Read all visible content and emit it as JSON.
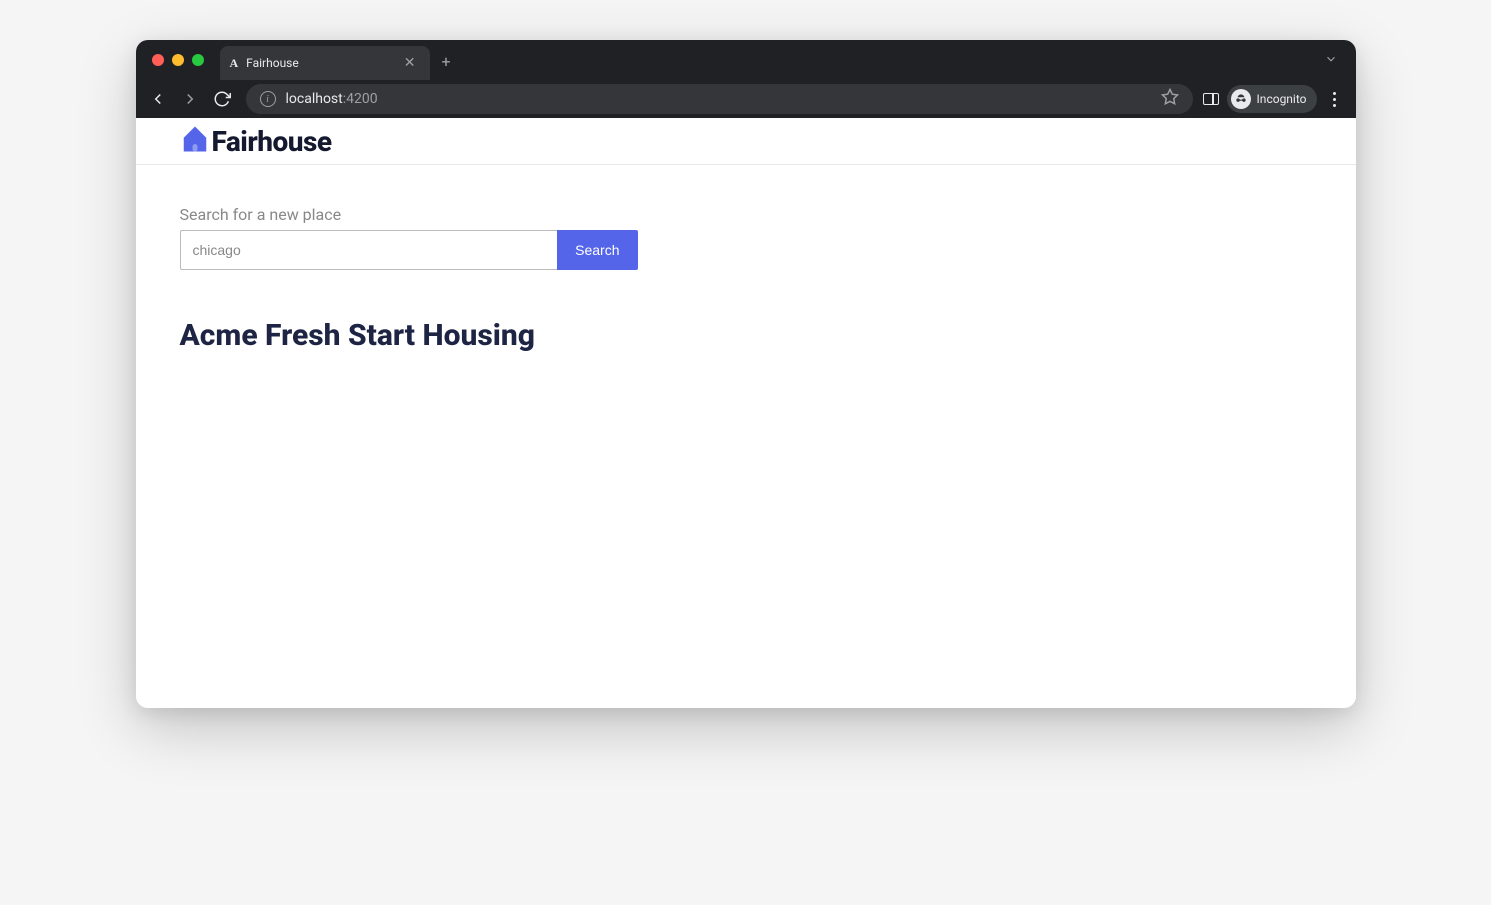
{
  "browser": {
    "tab": {
      "favicon": "A",
      "title": "Fairhouse"
    },
    "url": {
      "host": "localhost",
      "rest": ":4200"
    },
    "incognito_label": "Incognito"
  },
  "app": {
    "logo_text": "Fairhouse",
    "logo_color": "#5465ea"
  },
  "search": {
    "label": "Search for a new place",
    "value": "chicago",
    "button_label": "Search"
  },
  "result": {
    "heading": "Acme Fresh Start Housing"
  }
}
